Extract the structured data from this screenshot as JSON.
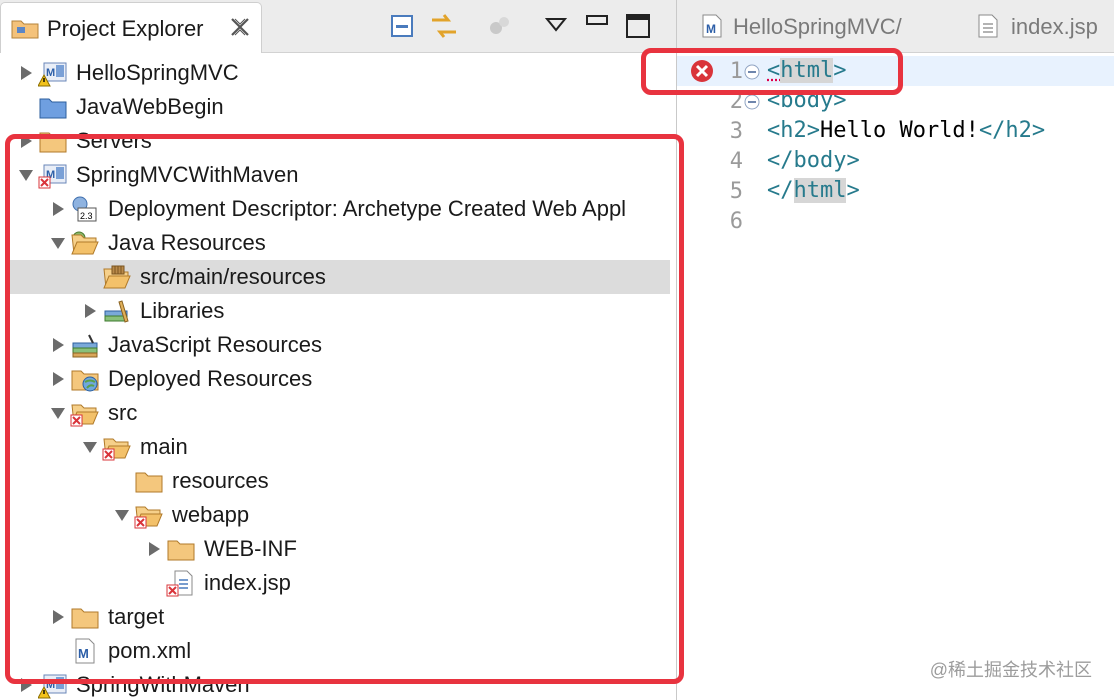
{
  "explorer": {
    "tab_title": "Project Explorer",
    "tab_icon": "project-explorer-icon",
    "close_icon": "close-icon",
    "toolbar_icons": [
      "collapse-all-icon",
      "link-with-editor-icon",
      "focus-icon",
      "view-menu-icon",
      "minimize-icon",
      "maximize-icon"
    ]
  },
  "tree": [
    {
      "label": "HelloSpringMVC",
      "icon": "maven-project-warning-icon",
      "expanded": false,
      "has_children": true
    },
    {
      "label": "JavaWebBegin",
      "icon": "project-folder-icon",
      "expanded": false,
      "has_children": false
    },
    {
      "label": "Servers",
      "icon": "folder-icon",
      "expanded": false,
      "has_children": true
    },
    {
      "label": "SpringMVCWithMaven",
      "icon": "maven-project-error-icon",
      "expanded": true,
      "has_children": true
    },
    {
      "label": "Deployment Descriptor: Archetype Created Web Appl",
      "icon": "deployment-descriptor-icon",
      "expanded": false,
      "has_children": true
    },
    {
      "label": "Java Resources",
      "icon": "java-resources-icon",
      "expanded": true,
      "has_children": true
    },
    {
      "label": "src/main/resources",
      "icon": "source-folder-icon",
      "expanded": false,
      "has_children": false,
      "selected": true
    },
    {
      "label": "Libraries",
      "icon": "libraries-icon",
      "expanded": false,
      "has_children": true
    },
    {
      "label": "JavaScript Resources",
      "icon": "javascript-resources-icon",
      "expanded": false,
      "has_children": true
    },
    {
      "label": "Deployed Resources",
      "icon": "deployed-resources-icon",
      "expanded": false,
      "has_children": true
    },
    {
      "label": "src",
      "icon": "folder-error-icon",
      "expanded": true,
      "has_children": true
    },
    {
      "label": "main",
      "icon": "folder-error-icon",
      "expanded": true,
      "has_children": true
    },
    {
      "label": "resources",
      "icon": "folder-icon",
      "expanded": false,
      "has_children": false
    },
    {
      "label": "webapp",
      "icon": "folder-error-icon",
      "expanded": true,
      "has_children": true
    },
    {
      "label": "WEB-INF",
      "icon": "folder-icon",
      "expanded": false,
      "has_children": true
    },
    {
      "label": "index.jsp",
      "icon": "jsp-file-error-icon",
      "expanded": false,
      "has_children": false
    },
    {
      "label": "target",
      "icon": "folder-icon",
      "expanded": false,
      "has_children": true
    },
    {
      "label": "pom.xml",
      "icon": "maven-pom-file-icon",
      "expanded": false,
      "has_children": false
    },
    {
      "label": "SpringWithMaven",
      "icon": "maven-project-warning-icon",
      "expanded": false,
      "has_children": true
    }
  ],
  "editor": {
    "tabs": [
      {
        "label": "HelloSpringMVC/",
        "icon": "maven-pom-file-icon"
      },
      {
        "label": "index.jsp",
        "icon": "jsp-file-icon"
      }
    ],
    "lines": [
      {
        "num": "1",
        "tokens": [
          {
            "t": "<",
            "c": "tag"
          },
          {
            "t": "html",
            "c": "tag"
          },
          {
            "t": ">",
            "c": "tag"
          }
        ],
        "error": true,
        "fold": true
      },
      {
        "num": "2",
        "tokens": [
          {
            "t": "<body>",
            "c": "tag"
          }
        ],
        "fold": true
      },
      {
        "num": "3",
        "tokens": [
          {
            "t": "<h2>",
            "c": "tag"
          },
          {
            "t": "Hello World!",
            "c": "txt"
          },
          {
            "t": "</h2>",
            "c": "tag"
          }
        ]
      },
      {
        "num": "4",
        "tokens": [
          {
            "t": "</body>",
            "c": "tag"
          }
        ]
      },
      {
        "num": "5",
        "tokens": [
          {
            "t": "</",
            "c": "tag"
          },
          {
            "t": "html",
            "c": "tag"
          },
          {
            "t": ">",
            "c": "tag"
          }
        ]
      },
      {
        "num": "6",
        "tokens": []
      }
    ]
  },
  "watermark": "@稀土掘金技术社区",
  "colors": {
    "annotation_red": "#e8333f",
    "tag": "#267a8c",
    "error_red": "#d9343a",
    "selection": "#dcdcdc"
  }
}
